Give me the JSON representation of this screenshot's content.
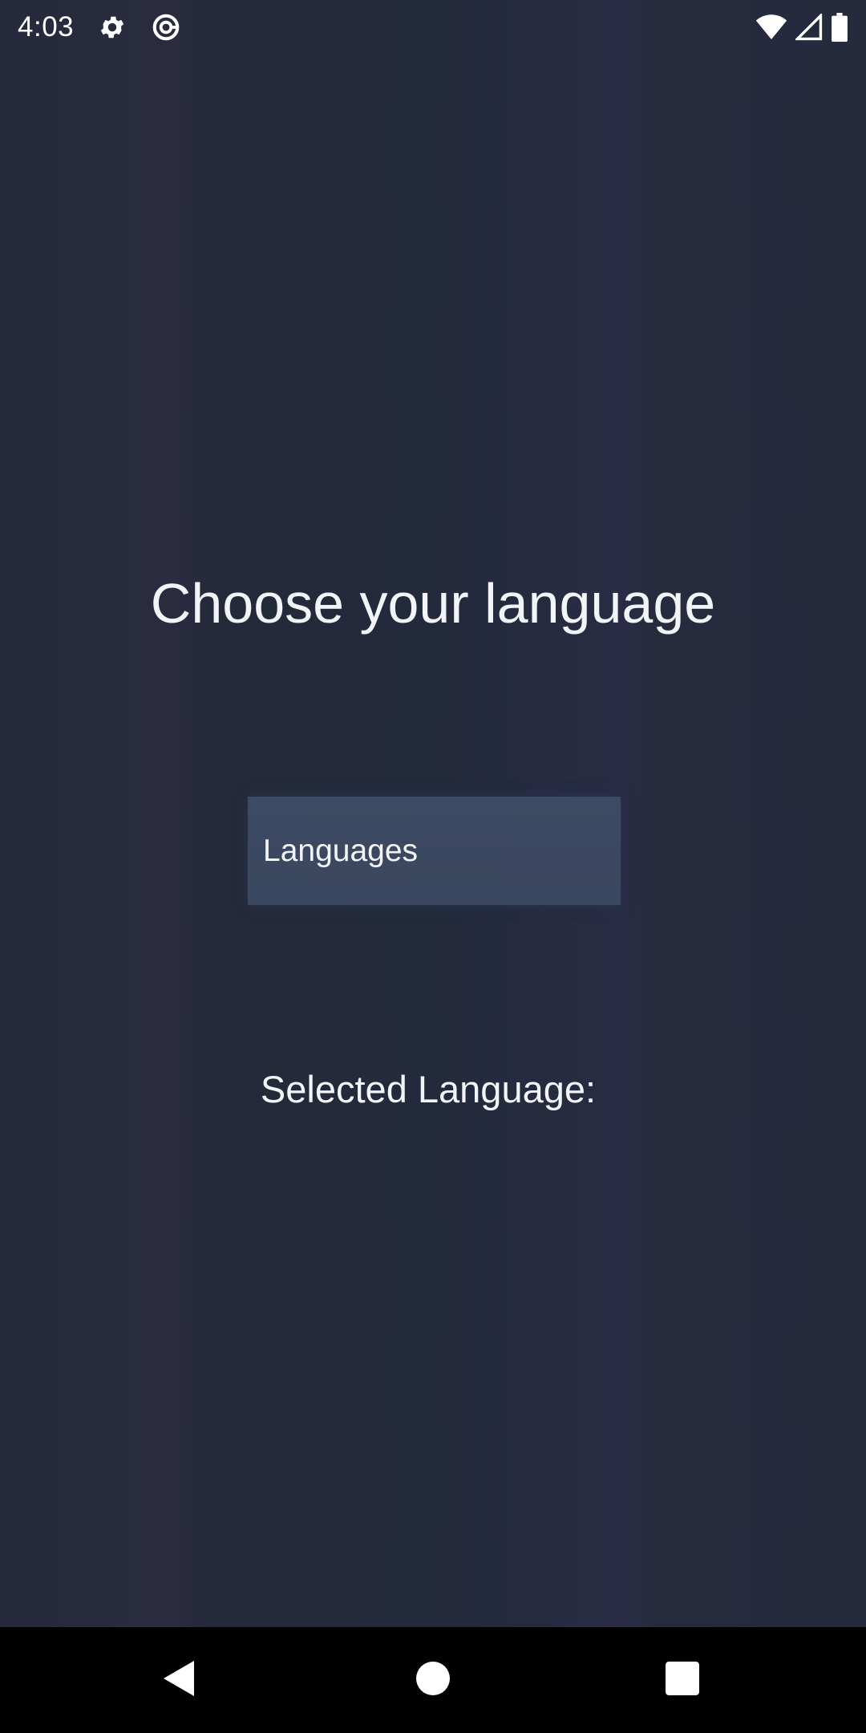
{
  "status_bar": {
    "time": "4:03",
    "icons": [
      "gear-icon",
      "data-saver-icon",
      "wifi-icon",
      "signal-icon",
      "battery-icon"
    ]
  },
  "main": {
    "title": "Choose your language",
    "languages_button_label": "Languages",
    "selected_language_label": "Selected Language:",
    "selected_language_value": ""
  },
  "nav_bar": {
    "icons": [
      "back-icon",
      "home-icon",
      "recents-icon"
    ]
  },
  "colors": {
    "background": "#252a3c",
    "button": "#3c4962",
    "text": "#f3f4f8",
    "nav_bar": "#000000"
  }
}
